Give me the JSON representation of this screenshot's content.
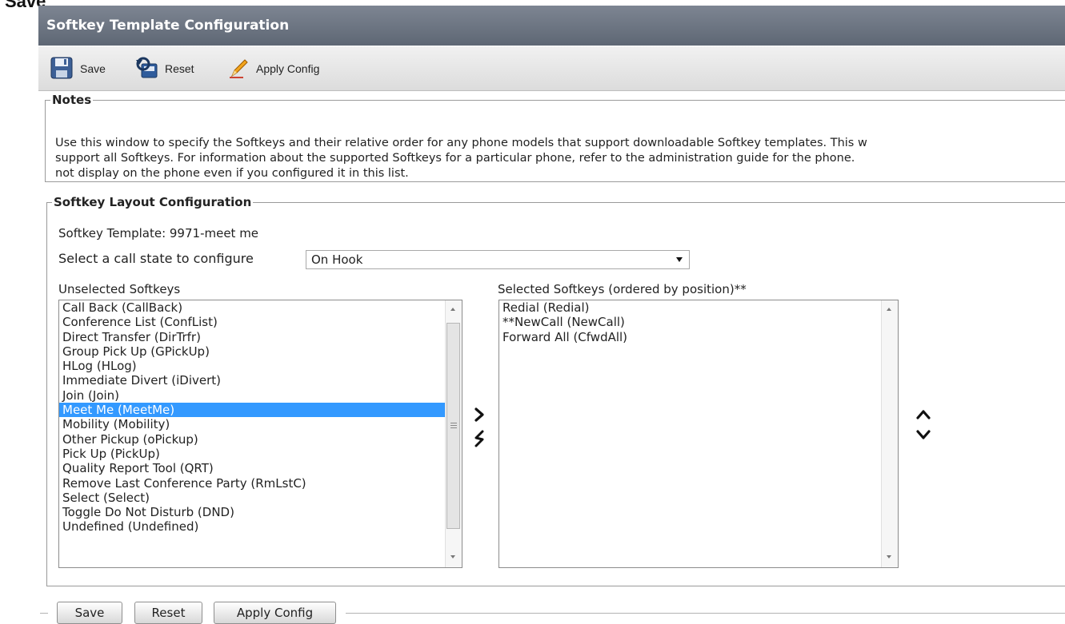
{
  "page_top_cropped_label": "Save",
  "title": "Softkey Template Configuration",
  "toolbar": {
    "save_label": "Save",
    "reset_label": "Reset",
    "apply_label": "Apply Config"
  },
  "notes": {
    "legend": "Notes",
    "text": "Use this window to specify the Softkeys and their relative order for any phone models that support downloadable Softkey templates. This w\nsupport all Softkeys. For information about the supported Softkeys for a particular phone, refer to the administration guide for the phone.\nnot display on the phone even if you configured it in this list."
  },
  "layout": {
    "legend": "Softkey Layout Configuration",
    "template_label": "Softkey Template: 9971-meet me",
    "call_state_label": "Select a call state to configure",
    "call_state_value": "On Hook",
    "unselected_label": "Unselected Softkeys",
    "selected_label": "Selected Softkeys (ordered by position)**",
    "unselected": [
      "Call Back (CallBack)",
      "Conference List (ConfList)",
      "Direct Transfer (DirTrfr)",
      "Group Pick Up (GPickUp)",
      "HLog (HLog)",
      "Immediate Divert (iDivert)",
      "Join (Join)",
      "Meet Me (MeetMe)",
      "Mobility (Mobility)",
      "Other Pickup (oPickup)",
      "Pick Up (PickUp)",
      "Quality Report Tool (QRT)",
      "Remove Last Conference Party (RmLstC)",
      "Select (Select)",
      "Toggle Do Not Disturb (DND)",
      "Undefined (Undefined)"
    ],
    "unselected_highlighted": "Meet Me (MeetMe)",
    "selected": [
      "Redial (Redial)",
      "**NewCall (NewCall)",
      "Forward All (CfwdAll)"
    ]
  },
  "bottom": {
    "save_label": "Save",
    "reset_label": "Reset",
    "apply_label": "Apply Config"
  }
}
